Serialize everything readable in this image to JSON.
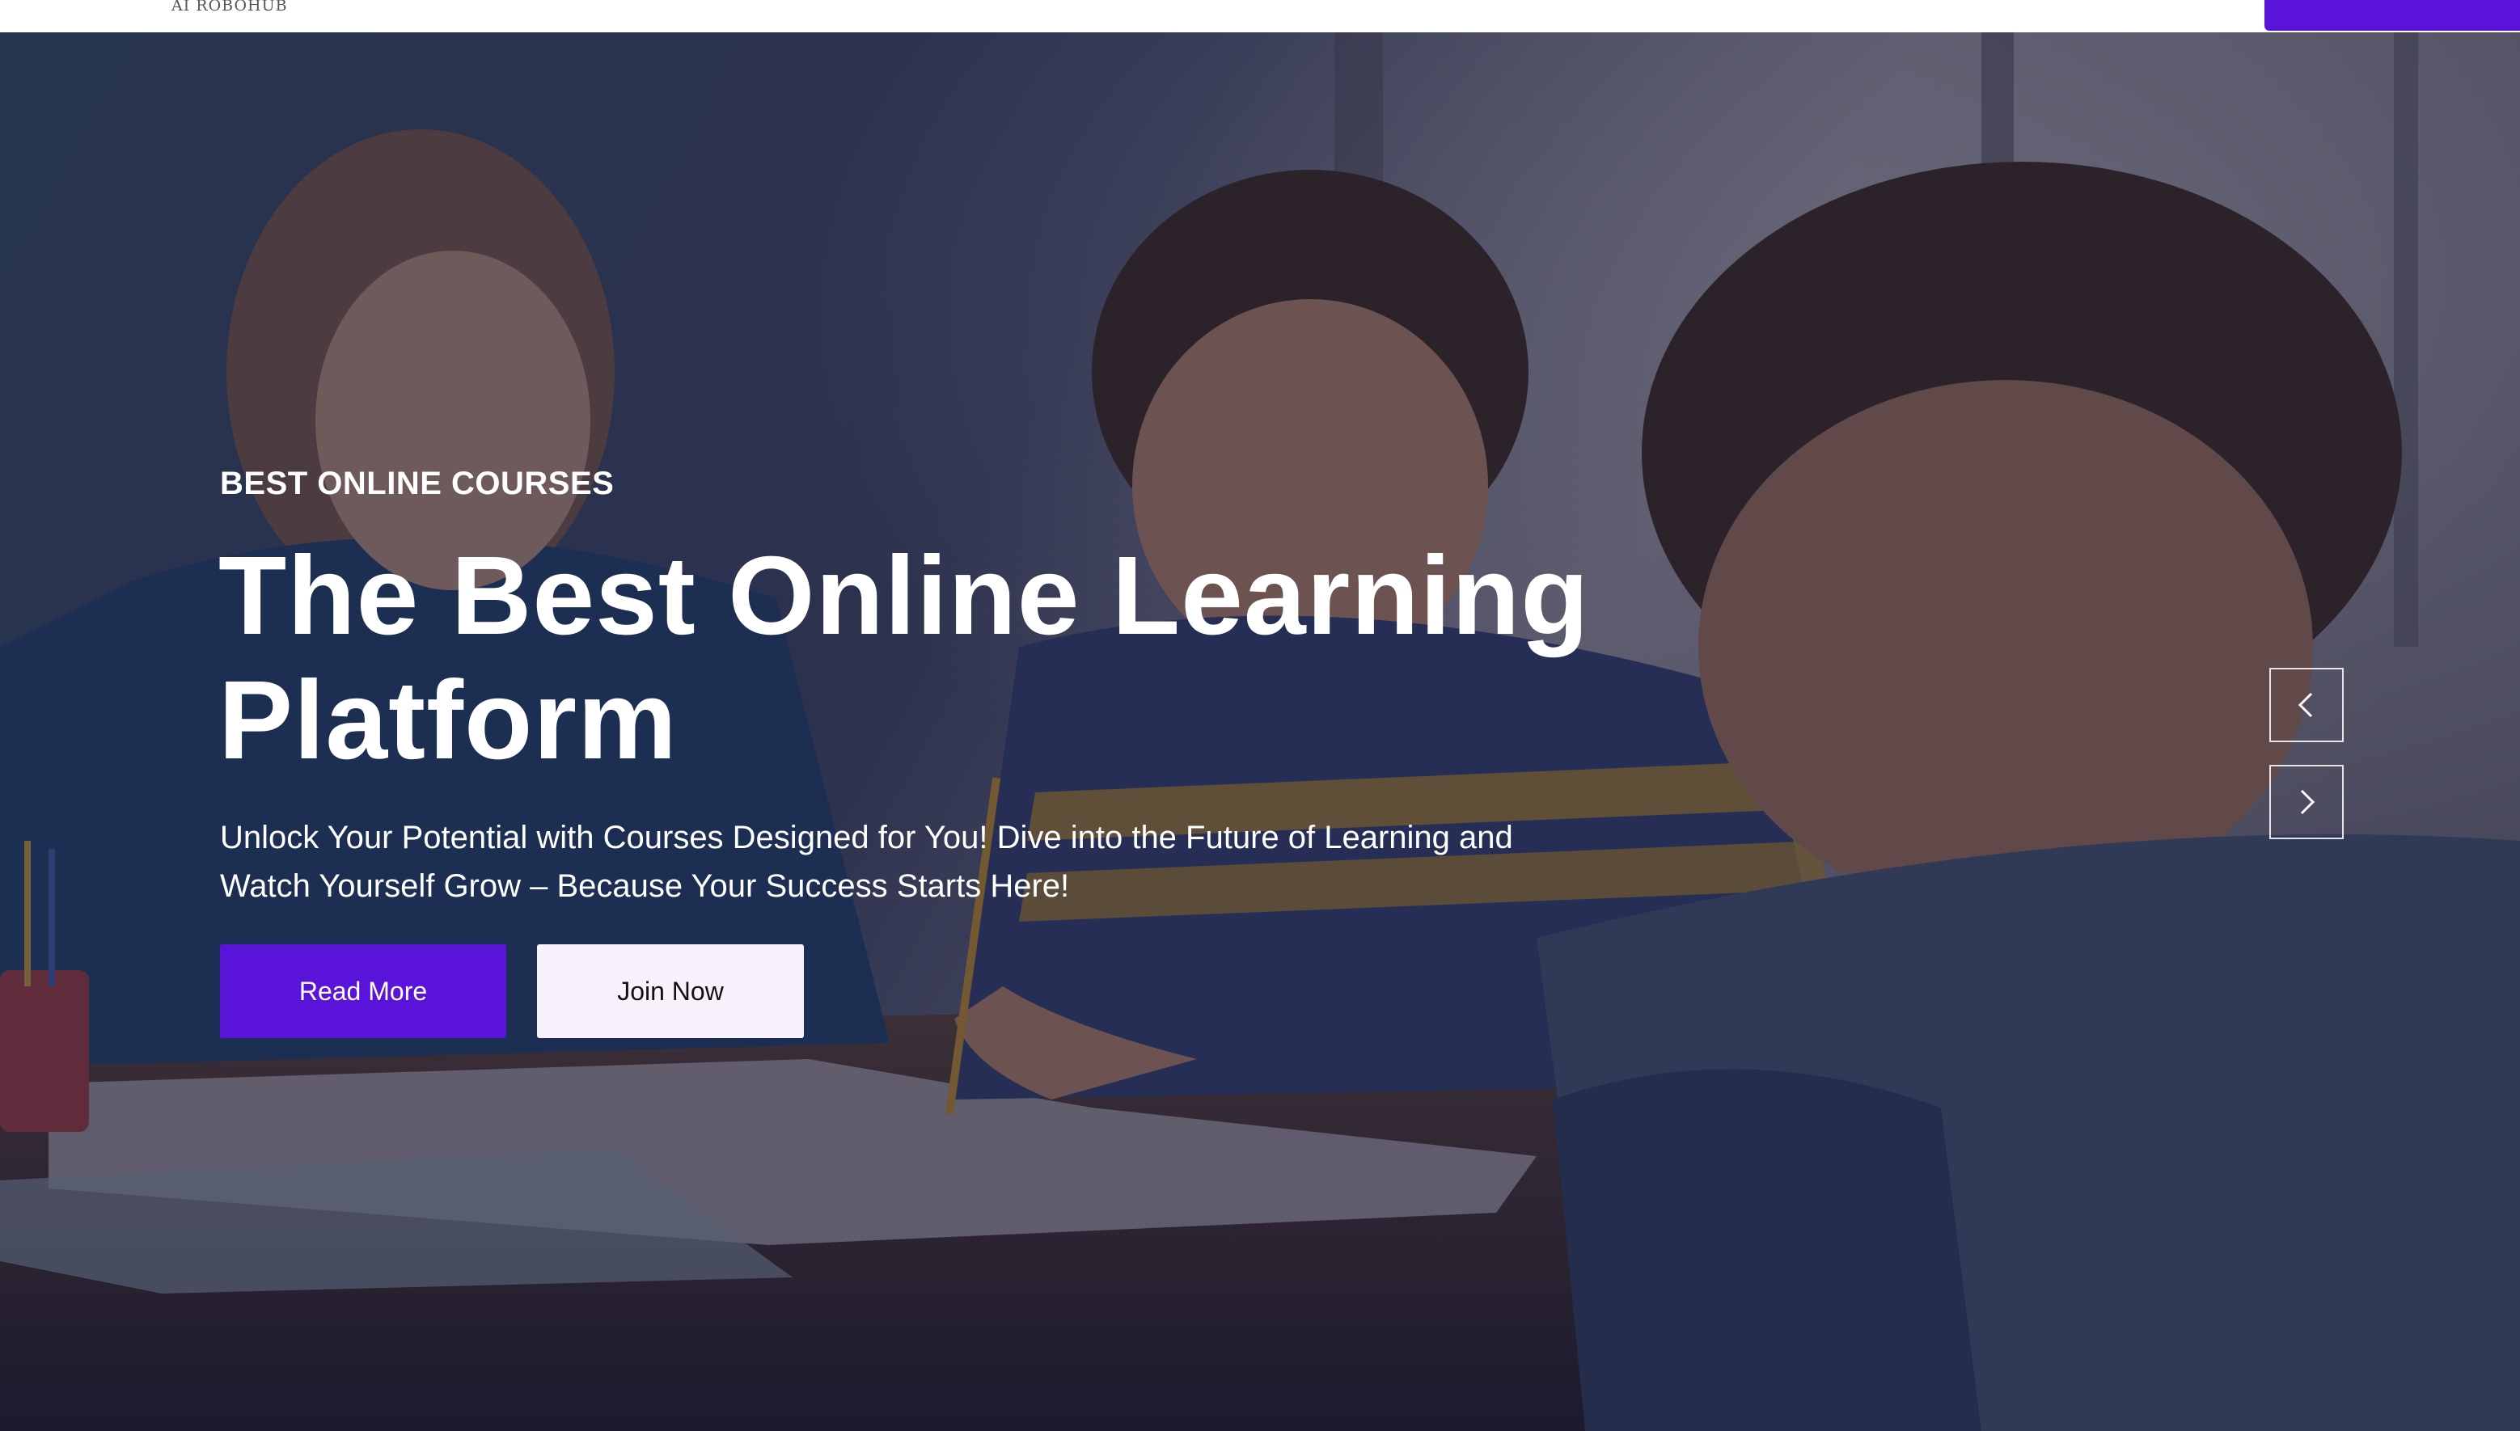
{
  "header": {
    "brand": "AI ROBOHUB"
  },
  "hero": {
    "eyebrow": "BEST ONLINE COURSES",
    "title_line1": "The Best Online Learning",
    "title_line2": "Platform",
    "subtitle_line1": "Unlock Your Potential with Courses Designed for You! Dive into the Future of Learning and",
    "subtitle_line2": "Watch Yourself Grow – Because Your Success Starts Here!",
    "primary_button": "Read More",
    "secondary_button": "Join Now",
    "carousel": {
      "prev_icon": "chevron-left-icon",
      "next_icon": "chevron-right-icon"
    }
  },
  "colors": {
    "accent": "#5a14d9",
    "secondary_button_bg": "#f7f2fc",
    "overlay": "#12142d"
  }
}
